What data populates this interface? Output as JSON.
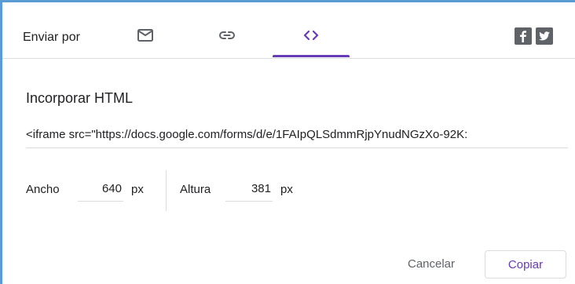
{
  "header": {
    "send_label": "Enviar por",
    "tabs": [
      {
        "name": "email",
        "icon": "email-icon"
      },
      {
        "name": "link",
        "icon": "link-icon"
      },
      {
        "name": "embed",
        "icon": "code-icon",
        "active": true
      }
    ],
    "social": [
      {
        "name": "facebook",
        "icon": "facebook-icon"
      },
      {
        "name": "twitter",
        "icon": "twitter-icon"
      }
    ]
  },
  "embed": {
    "title": "Incorporar HTML",
    "code": "<iframe src=\"https://docs.google.com/forms/d/e/1FAIpQLSdmmRjpYnudNGzXo-92K:"
  },
  "dimensions": {
    "width_label": "Ancho",
    "width_value": "640",
    "width_unit": "px",
    "height_label": "Altura",
    "height_value": "381",
    "height_unit": "px"
  },
  "actions": {
    "cancel": "Cancelar",
    "copy": "Copiar"
  },
  "colors": {
    "accent": "#673ab7",
    "icon": "#5f6368",
    "divider": "#dadce0",
    "frame": "#5b9bd5"
  }
}
